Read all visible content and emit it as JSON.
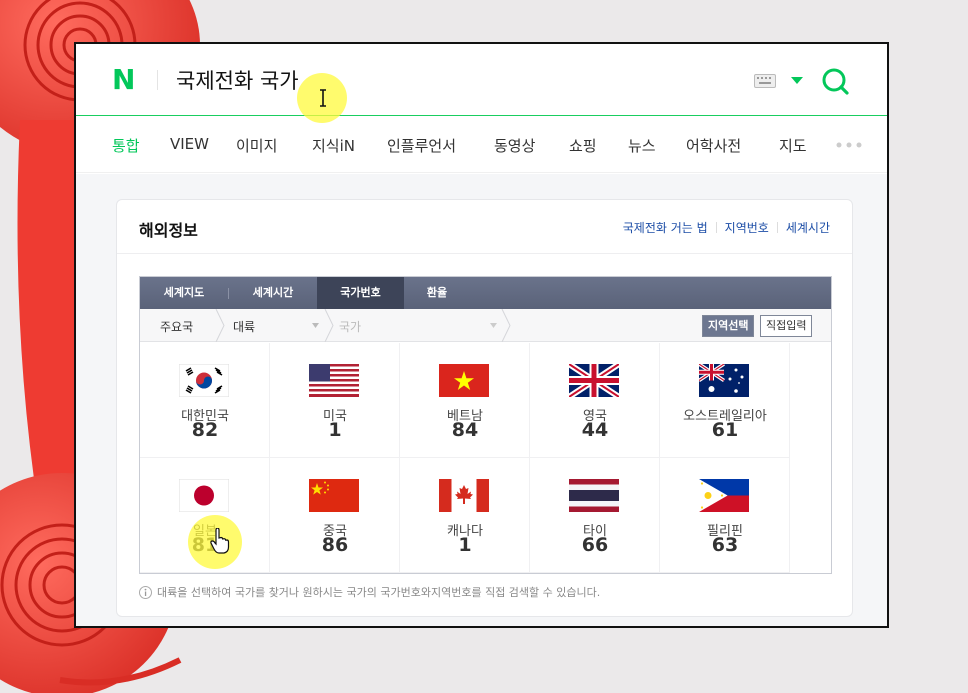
{
  "search": {
    "logo": "N",
    "query": "국제전화 국가"
  },
  "tabs": [
    {
      "label": "통합",
      "active": true
    },
    {
      "label": "VIEW"
    },
    {
      "label": "이미지"
    },
    {
      "label": "지식iN"
    },
    {
      "label": "인플루언서"
    },
    {
      "label": "동영상"
    },
    {
      "label": "쇼핑"
    },
    {
      "label": "뉴스"
    },
    {
      "label": "어학사전"
    },
    {
      "label": "지도"
    }
  ],
  "card": {
    "title": "해외정보",
    "links": [
      "국제전화 거는 법",
      "지역번호",
      "세계시간"
    ]
  },
  "widget": {
    "tabs": [
      "세계지도",
      "세계시간",
      "국가번호",
      "환율"
    ],
    "active_tab": "국가번호",
    "filters": {
      "major": "주요국",
      "continent": "대륙",
      "country_placeholder": "국가"
    },
    "buttons": {
      "region_select": "지역선택",
      "direct_input": "직접입력"
    },
    "countries": [
      {
        "name": "대한민국",
        "code": "82",
        "flag": "korea-flag"
      },
      {
        "name": "미국",
        "code": "1",
        "flag": "usa-flag"
      },
      {
        "name": "베트남",
        "code": "84",
        "flag": "vietnam-flag"
      },
      {
        "name": "영국",
        "code": "44",
        "flag": "uk-flag"
      },
      {
        "name": "오스트레일리아",
        "code": "61",
        "flag": "australia-flag"
      },
      {
        "name": "일본",
        "code": "81",
        "flag": "japan-flag"
      },
      {
        "name": "중국",
        "code": "86",
        "flag": "china-flag"
      },
      {
        "name": "캐나다",
        "code": "1",
        "flag": "canada-flag"
      },
      {
        "name": "타이",
        "code": "66",
        "flag": "thailand-flag"
      },
      {
        "name": "필리핀",
        "code": "63",
        "flag": "philippines-flag"
      }
    ]
  },
  "note": "대륙을 선택하여 국가를 찾거나 원하시는 국가의 국가번호와지역번호를 직접 검색할 수 있습니다.",
  "colors": {
    "brand_green": "#03c75a",
    "link_blue": "#1d4ea7",
    "widget_tab_bg": "#5a6279",
    "phone_red": "#f2453d"
  }
}
